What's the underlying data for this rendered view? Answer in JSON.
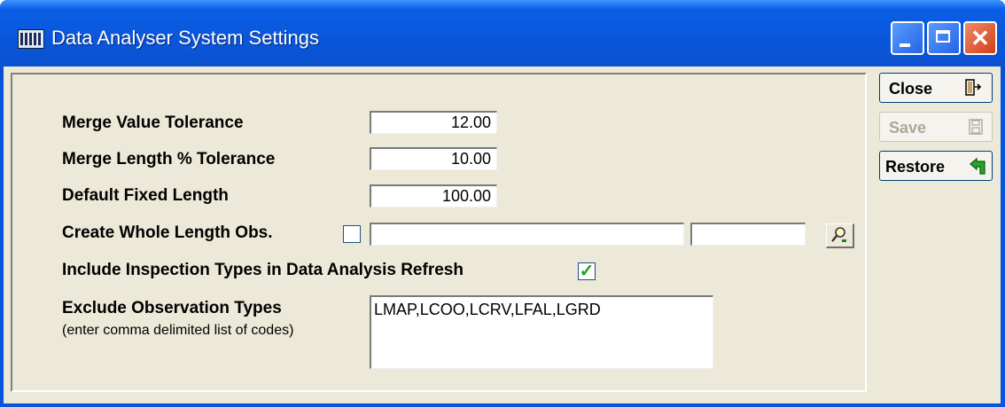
{
  "window": {
    "title": "Data Analyser System Settings",
    "icon": "app-grid-icon"
  },
  "buttons": {
    "close_label": "Close",
    "save_label": "Save",
    "restore_label": "Restore"
  },
  "form": {
    "merge_value_tolerance": {
      "label": "Merge Value Tolerance",
      "value": "12.00"
    },
    "merge_length_tolerance": {
      "label": "Merge Length % Tolerance",
      "value": "10.00"
    },
    "default_fixed_length": {
      "label": "Default Fixed Length",
      "value": "100.00"
    },
    "create_whole_length_obs": {
      "label": "Create Whole Length Obs.",
      "checked": false,
      "code": "",
      "description": ""
    },
    "include_inspection_types": {
      "label": "Include Inspection Types in Data Analysis Refresh",
      "checked": true
    },
    "exclude_observation_types": {
      "label": "Exclude Observation Types",
      "hint": "(enter comma delimited list of codes)",
      "value": "LMAP,LCOO,LCRV,LFAL,LGRD"
    }
  },
  "colors": {
    "titlebar": "#0a55d8",
    "client_background": "#ece9d8",
    "close_button": "#d23e1a",
    "checkmark": "#21a121"
  }
}
